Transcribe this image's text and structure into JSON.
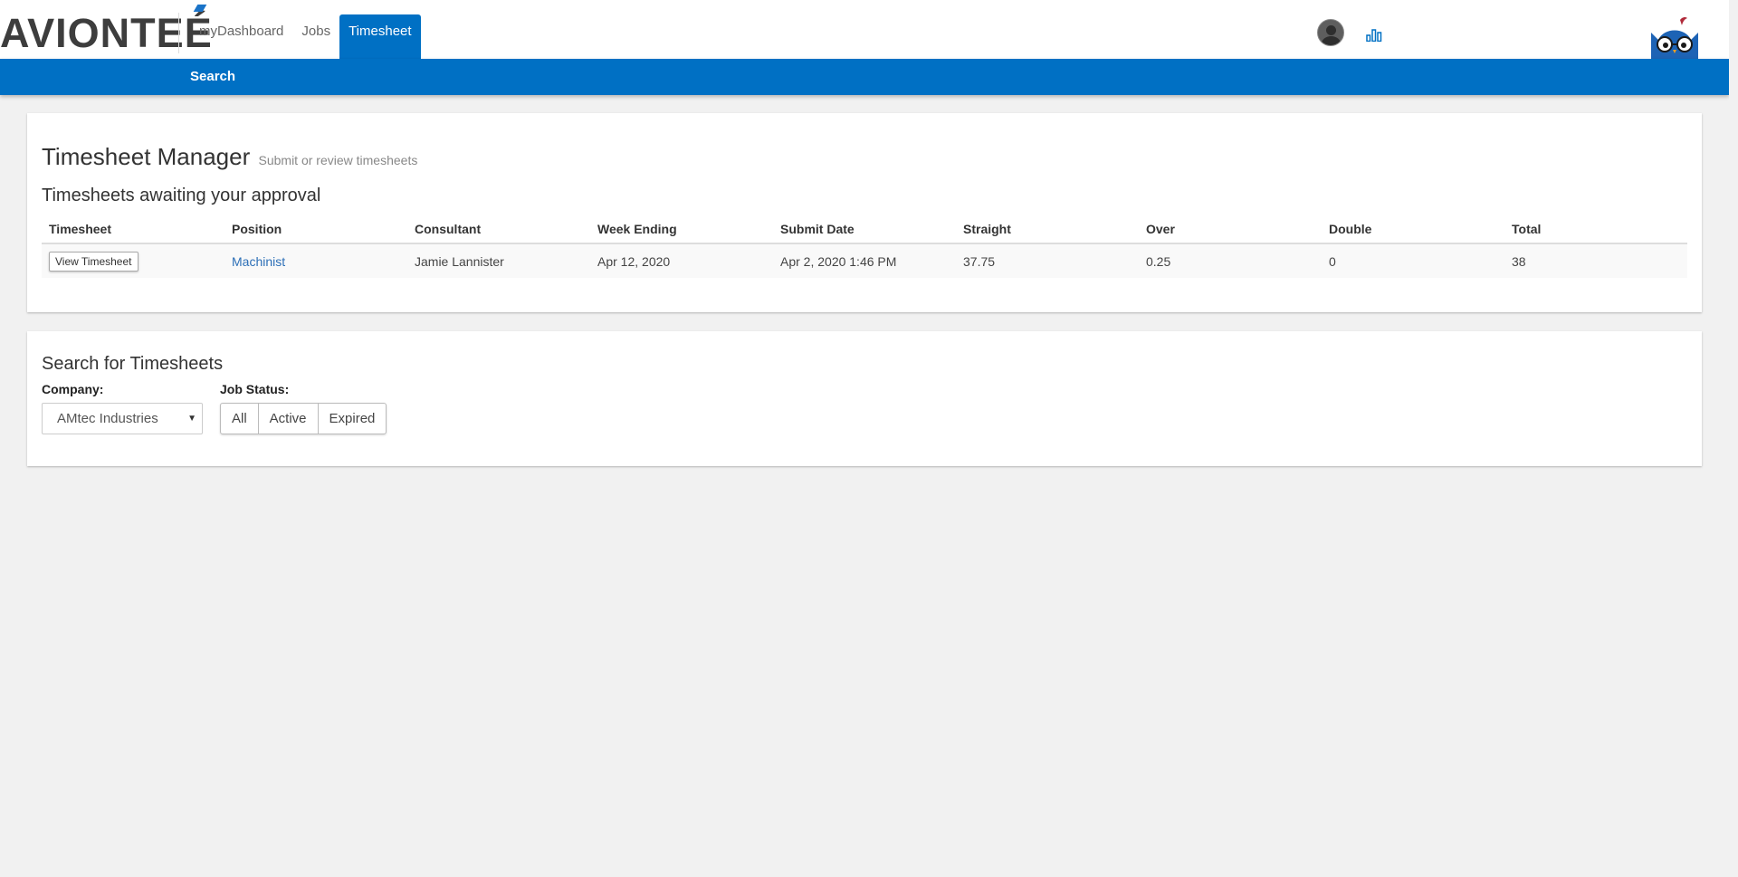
{
  "brand": {
    "logo_text": "AVIONTE",
    "logo_accent": "É"
  },
  "nav": {
    "items": [
      {
        "label": "myDashboard"
      },
      {
        "label": "Jobs"
      },
      {
        "label": "Timesheet"
      }
    ],
    "active": "Timesheet"
  },
  "subnav": {
    "items": [
      {
        "label": "Search"
      }
    ]
  },
  "colors": {
    "primary": "#0070c4",
    "link": "#2c6fb7",
    "background": "#f1f1f1"
  },
  "manager": {
    "title": "Timesheet Manager",
    "subtitle": "Submit or review timesheets",
    "section_title": "Timesheets awaiting your approval",
    "columns": [
      "Timesheet",
      "Position",
      "Consultant",
      "Week Ending",
      "Submit Date",
      "Straight",
      "Over",
      "Double",
      "Total"
    ],
    "rows": [
      {
        "action_label": "View Timesheet",
        "position": "Machinist",
        "consultant": "Jamie Lannister",
        "week_ending": "Apr 12, 2020",
        "submit_date": "Apr 2, 2020 1:46 PM",
        "straight": "37.75",
        "over": "0.25",
        "double": "0",
        "total": "38"
      }
    ]
  },
  "search": {
    "title": "Search for Timesheets",
    "company_label": "Company:",
    "company_value": "AMtec Industries",
    "job_status_label": "Job Status:",
    "job_status_options": [
      "All",
      "Active",
      "Expired"
    ]
  },
  "icons": [
    "user-avatar-icon",
    "bar-chart-icon",
    "owl-mascot-icon",
    "caret-down-icon"
  ]
}
